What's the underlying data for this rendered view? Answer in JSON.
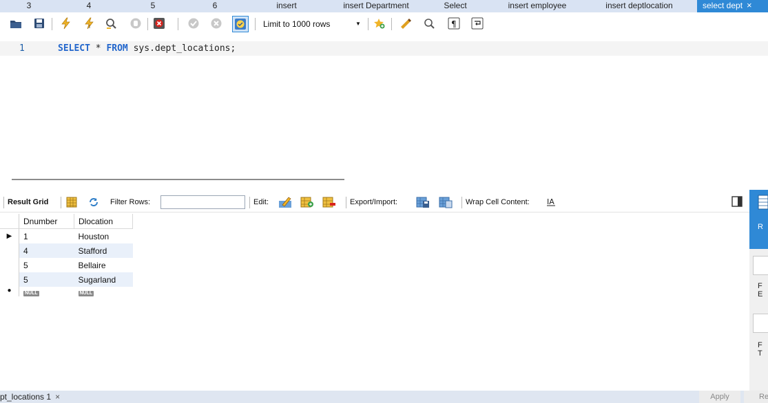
{
  "tabs": [
    {
      "label": "3"
    },
    {
      "label": "4"
    },
    {
      "label": "5"
    },
    {
      "label": "6"
    },
    {
      "label": "insert"
    },
    {
      "label": "insert Department"
    },
    {
      "label": "Select"
    },
    {
      "label": "insert employee"
    },
    {
      "label": "insert deptlocation"
    },
    {
      "label": "select dept",
      "active": true
    }
  ],
  "toolbar": {
    "limit_label": "Limit to 1000 rows",
    "icons": [
      "open-folder-icon",
      "save-icon",
      "execute-icon",
      "execute-current-icon",
      "explain-icon",
      "stop-icon",
      "toggle-error-icon",
      "commit-icon",
      "rollback-icon",
      "autocommit-icon",
      "add-snippet-icon",
      "beautify-icon",
      "find-icon",
      "invisible-chars-icon",
      "word-wrap-icon"
    ]
  },
  "editor": {
    "line_number": "1",
    "kw1": "SELECT",
    "op": " * ",
    "kw2": "FROM",
    "rest": " sys.dept_locations;"
  },
  "result_toolbar": {
    "result_grid": "Result Grid",
    "filter_rows": "Filter Rows:",
    "filter_value": "",
    "edit": "Edit:",
    "export_import": "Export/Import:",
    "wrap_cell": "Wrap Cell Content:"
  },
  "grid": {
    "columns": [
      "Dnumber",
      "Dlocation"
    ],
    "rows": [
      [
        "1",
        "Houston"
      ],
      [
        "4",
        "Stafford"
      ],
      [
        "5",
        "Bellaire"
      ],
      [
        "5",
        "Sugarland"
      ]
    ],
    "null_label": "NULL"
  },
  "right_panel": {
    "items": [
      "R",
      "F\nE",
      "F\nT"
    ]
  },
  "bottom": {
    "tab_label": "pt_locations 1",
    "close": "×",
    "apply": "Apply",
    "revert": "Re"
  },
  "colors": {
    "accent": "#2f89d6",
    "tabbar": "#d9e3f3",
    "alt_row": "#e9f0fa",
    "keyword": "#2266cc"
  }
}
